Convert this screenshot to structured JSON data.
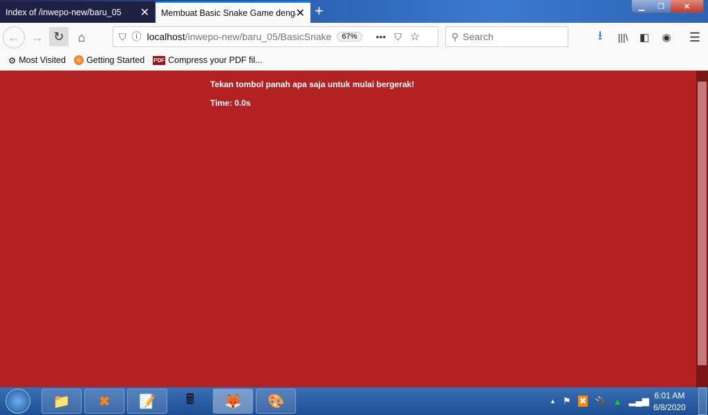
{
  "tabs": [
    {
      "title": "Index of /inwepo-new/baru_05",
      "active": false
    },
    {
      "title": "Membuat Basic Snake Game dengan",
      "active": true
    }
  ],
  "url": {
    "host": "localhost",
    "path": "/inwepo-new/baru_05/BasicSnake",
    "zoom": "67%"
  },
  "search": {
    "placeholder": "Search"
  },
  "bookmarks": [
    {
      "label": "Most Visited",
      "icon": "gear-icon"
    },
    {
      "label": "Getting Started",
      "icon": "firefox-icon"
    },
    {
      "label": "Compress your PDF fil...",
      "icon": "pdf-icon"
    }
  ],
  "page": {
    "instruction": "Tekan tombol panah apa saja untuk mulai bergerak!",
    "time": "Time: 0.0s",
    "background": "#b22222"
  },
  "clock": {
    "time": "6:01 AM",
    "date": "6/8/2020"
  }
}
